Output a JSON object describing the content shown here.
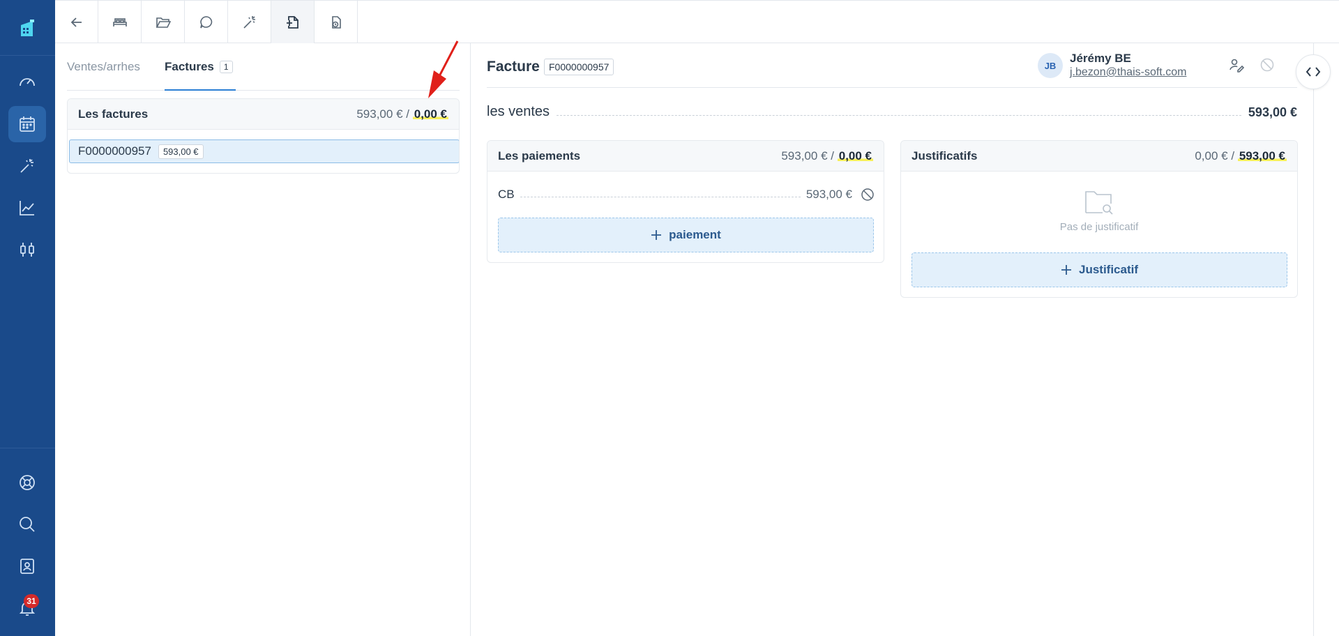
{
  "sidebar": {
    "icons": [
      "logo-icon",
      "dashboard-icon",
      "calendar-icon",
      "magic-wand-icon",
      "chart-icon",
      "settings-sliders-icon",
      "help-icon",
      "search-icon",
      "contacts-icon",
      "bell-icon"
    ],
    "notification_count": "31"
  },
  "toolbar": {
    "icons": [
      "back-arrow-icon",
      "bed-icon",
      "folder-icon",
      "chat-icon",
      "magic-wand-icon",
      "invoice-add-icon",
      "history-icon"
    ]
  },
  "left": {
    "tabs": [
      {
        "label": "Ventes/arrhes"
      },
      {
        "label": "Factures",
        "count": "1"
      }
    ],
    "invoices_card": {
      "title": "Les factures",
      "total": "593,00 €",
      "separator": "/",
      "remaining": "0,00 €"
    },
    "invoice_row": {
      "number": "F0000000957",
      "amount": "593,00 €"
    }
  },
  "right": {
    "title": "Facture",
    "invoice_number": "F0000000957",
    "user": {
      "initials": "JB",
      "name": "Jérémy BE",
      "email": "j.bezon@thais-soft.com"
    },
    "sales": {
      "label": "les ventes",
      "amount": "593,00 €"
    },
    "payments_card": {
      "title": "Les paiements",
      "total": "593,00 €",
      "separator": "/",
      "remaining": "0,00 €",
      "line_label": "CB",
      "line_amount": "593,00 €",
      "add_label": "paiement"
    },
    "docs_card": {
      "title": "Justificatifs",
      "total": "0,00 €",
      "separator": "/",
      "remaining": "593,00 €",
      "empty_text": "Pas de justificatif",
      "add_label": "Justificatif"
    }
  },
  "colors": {
    "sidebar": "#1a4a8a",
    "accent": "#2b7fd4",
    "highlight": "#f7ef5a",
    "arrow": "#e0201a"
  }
}
